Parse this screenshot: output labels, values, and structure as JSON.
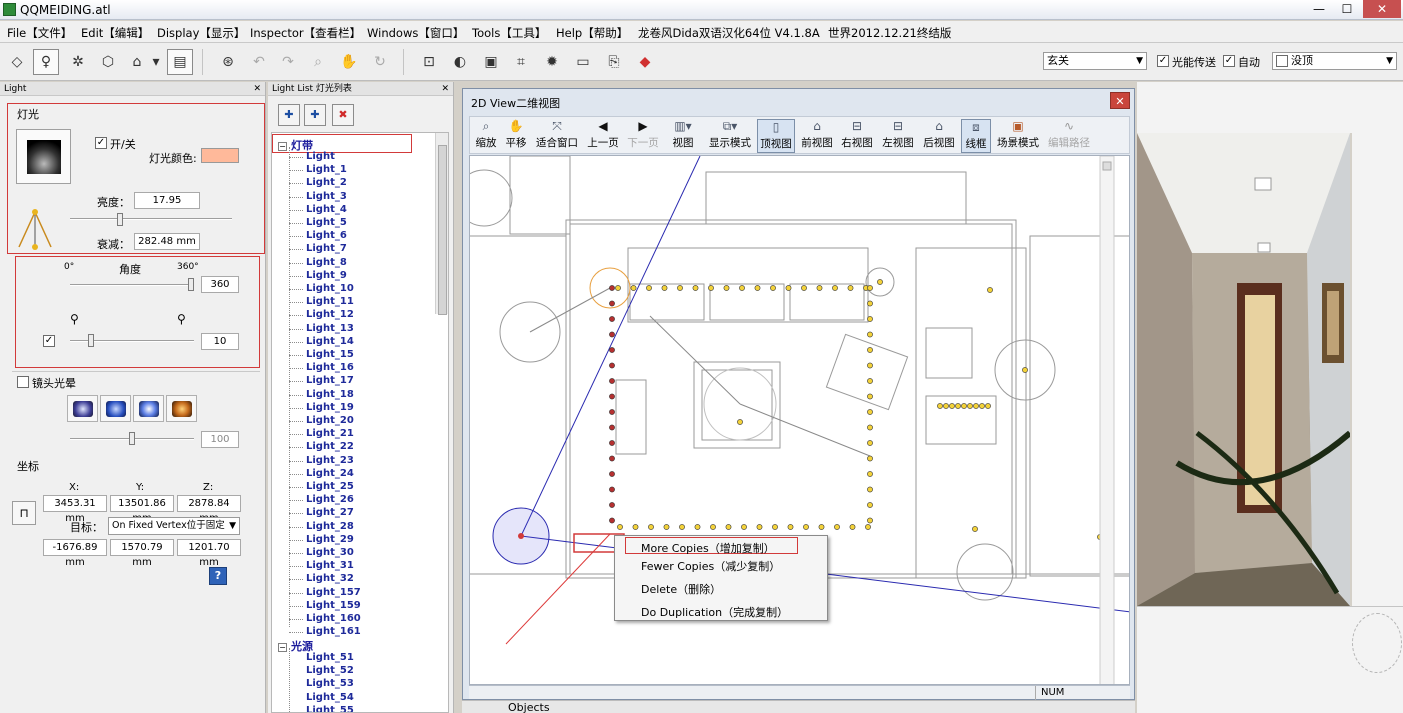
{
  "window": {
    "title": "QQMEIDING.atl"
  },
  "menu": [
    {
      "label": "File【文件】"
    },
    {
      "label": "Edit【编辑】"
    },
    {
      "label": "Display【显示】"
    },
    {
      "label": "Inspector【查看栏】"
    },
    {
      "label": "Windows【窗口】"
    },
    {
      "label": "Tools【工具】"
    },
    {
      "label": "Help【帮助】"
    },
    {
      "label": "龙卷风Dida双语汉化64位 V4.1.8A"
    },
    {
      "label": "世界2012.12.21终结版"
    }
  ],
  "toolbar": {
    "combo1": "玄关",
    "check1_label": "光能传送",
    "check2_label": "自动",
    "combo2": "没顶"
  },
  "light_panel": {
    "header": "Light",
    "section_title": "灯光",
    "on_off_label": "开/关",
    "color_label": "灯光颜色:",
    "color": "#ffb99a",
    "brightness_label": "亮度：",
    "brightness_value": "17.95",
    "brightness_level": 0.3,
    "falloff_label": "衰减：",
    "falloff_value": "282.48 mm",
    "angle_min": "0°",
    "angle_label": "角度",
    "angle_max": "360°",
    "angle_value": "360",
    "angle_level": 1.0,
    "spot_value": "10",
    "spot_level": 0.15,
    "lens_flare_label": "镜头光晕",
    "lens_value": "100",
    "lens_level": 0.5,
    "coords_label": "坐标",
    "x_label": "X:",
    "y_label": "Y:",
    "z_label": "Z:",
    "x_value": "3453.31 mm",
    "y_value": "13501.86 mm",
    "z_value": "2878.84 mm",
    "target_label": "目标：",
    "target_mode": "On Fixed Vertex位于固定",
    "tx_value": "-1676.89 mm",
    "ty_value": "1570.79 mm",
    "tz_value": "1201.70 mm",
    "help_label": "?"
  },
  "light_list": {
    "header": "Light List 灯光列表",
    "groups": [
      {
        "name": "灯带",
        "items": [
          "Light",
          "Light_1",
          "Light_2",
          "Light_3",
          "Light_4",
          "Light_5",
          "Light_6",
          "Light_7",
          "Light_8",
          "Light_9",
          "Light_10",
          "Light_11",
          "Light_12",
          "Light_13",
          "Light_14",
          "Light_15",
          "Light_16",
          "Light_17",
          "Light_18",
          "Light_19",
          "Light_20",
          "Light_21",
          "Light_22",
          "Light_23",
          "Light_24",
          "Light_25",
          "Light_26",
          "Light_27",
          "Light_28",
          "Light_29",
          "Light_30",
          "Light_31",
          "Light_32",
          "Light_157",
          "Light_159",
          "Light_160",
          "Light_161"
        ]
      },
      {
        "name": "光源",
        "items": [
          "Light_51",
          "Light_52",
          "Light_53",
          "Light_54",
          "Light_55"
        ]
      }
    ]
  },
  "view2d": {
    "title": "2D View二维视图",
    "tools": [
      {
        "label": "缩放",
        "icon": "zoom-icon"
      },
      {
        "label": "平移",
        "icon": "pan-icon"
      },
      {
        "label": "适合窗口",
        "icon": "fit-window-icon"
      },
      {
        "label": "上一页",
        "icon": "prev-page-icon"
      },
      {
        "label": "下一页",
        "icon": "next-page-icon"
      },
      {
        "label": "视图",
        "icon": "view-icon"
      },
      {
        "label": "显示模式",
        "icon": "display-mode-icon"
      },
      {
        "label": "顶视图",
        "icon": "top-view-icon"
      },
      {
        "label": "前视图",
        "icon": "front-view-icon"
      },
      {
        "label": "右视图",
        "icon": "right-view-icon"
      },
      {
        "label": "左视图",
        "icon": "left-view-icon"
      },
      {
        "label": "后视图",
        "icon": "back-view-icon"
      },
      {
        "label": "线框",
        "icon": "wireframe-icon"
      },
      {
        "label": "场景模式",
        "icon": "scene-mode-icon"
      },
      {
        "label": "编辑路径",
        "icon": "edit-path-icon"
      }
    ],
    "status": "NUM",
    "bottom_tab": "Objects"
  },
  "context_menu": [
    {
      "label": "More Copies（增加复制）"
    },
    {
      "label": "Fewer Copies（减少复制）"
    },
    {
      "label": "Delete（删除）"
    },
    {
      "label": "Do Duplication（完成复制）"
    }
  ]
}
